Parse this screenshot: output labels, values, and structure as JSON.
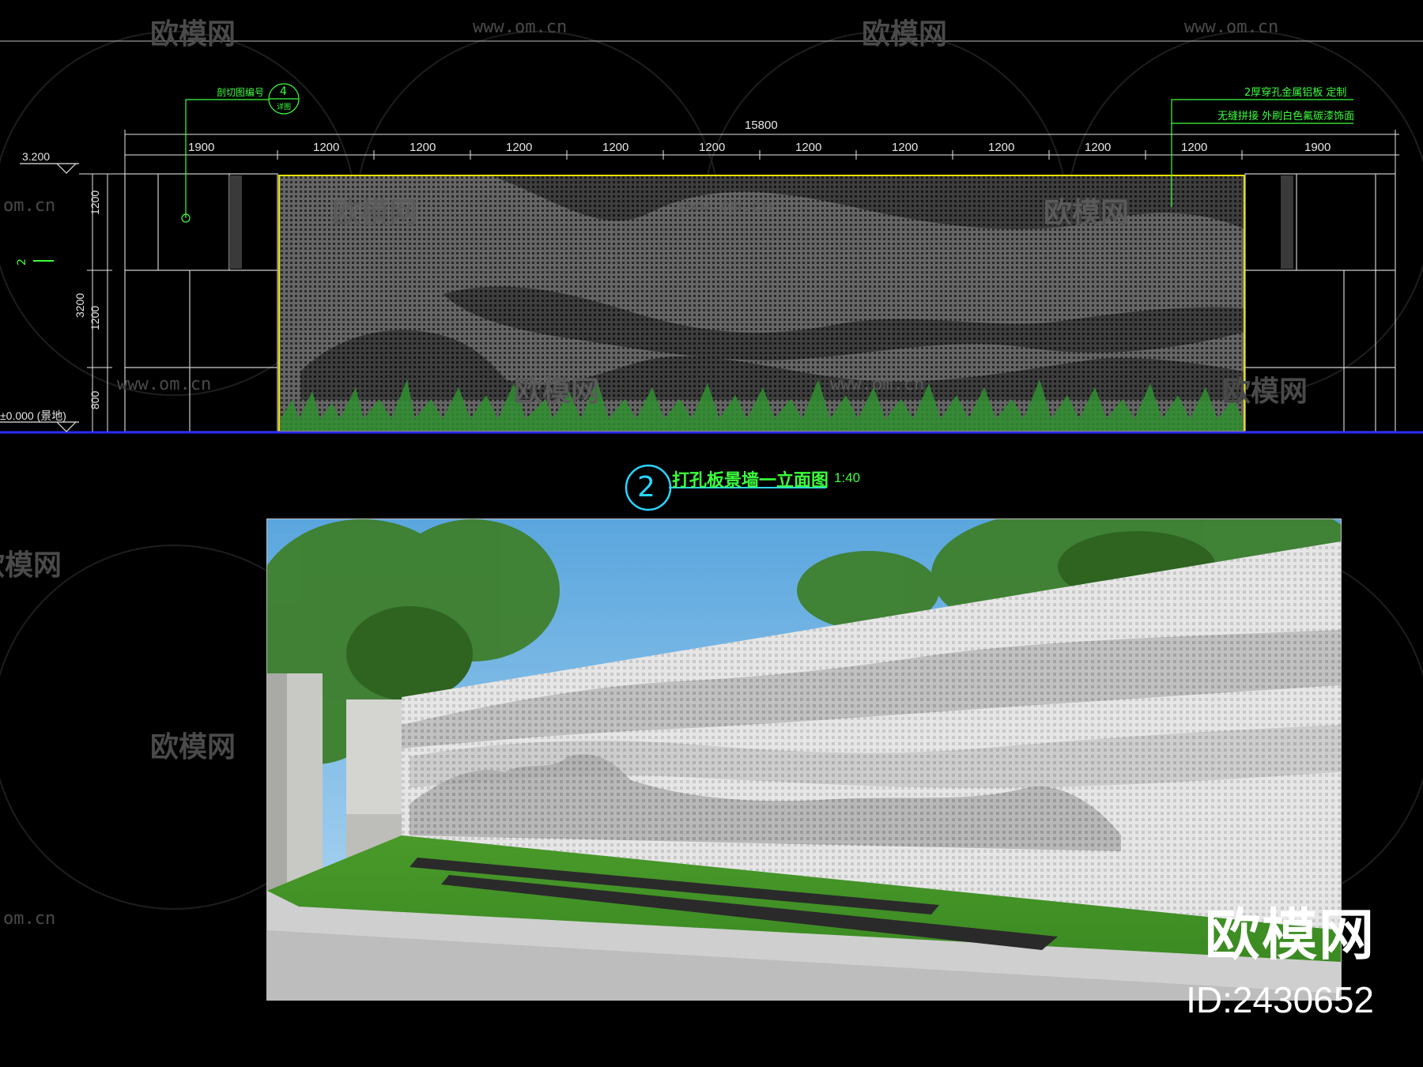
{
  "watermark": {
    "brand": "欧模网",
    "url": "www.om.cn",
    "url_short": "om.cn"
  },
  "elevation": {
    "overall_dim": "15800",
    "segment_dims": [
      "1900",
      "1200",
      "1200",
      "1200",
      "1200",
      "1200",
      "1200",
      "1200",
      "1200",
      "1200",
      "1200",
      "1900"
    ],
    "height_dims": [
      "1200",
      "1200",
      "800"
    ],
    "total_height": "3200",
    "level_top": "3.200",
    "level_base": "±0.000 (景地)",
    "side_mark": "2",
    "callout_left": {
      "text": "剖切图编号",
      "ref_top": "4",
      "ref_bottom": "详图"
    },
    "note_right": [
      "2厚穿孔金属铝板 定制",
      "无缝拼接 外刷白色氟碳漆饰面"
    ]
  },
  "drawing_title": {
    "number": "2",
    "text": "打孔板景墙一立面图",
    "scale": "1:40"
  },
  "brand_badge": {
    "name": "欧模网",
    "id": "ID:2430652"
  },
  "colors": {
    "background": "#000000",
    "annotation": "#3cff3c",
    "panel_outline": "#e6e000",
    "ground": "#2a2aff"
  }
}
